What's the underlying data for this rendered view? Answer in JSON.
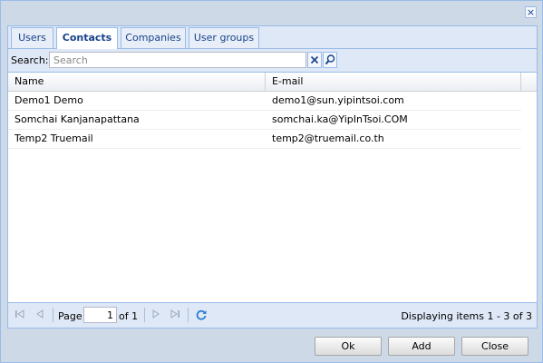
{
  "window": {
    "close_glyph": "×"
  },
  "tabs": [
    {
      "label": "Users",
      "active": false
    },
    {
      "label": "Contacts",
      "active": true
    },
    {
      "label": "Companies",
      "active": false
    },
    {
      "label": "User groups",
      "active": false
    }
  ],
  "search": {
    "label": "Search:",
    "placeholder": "Search",
    "value": ""
  },
  "grid": {
    "columns": [
      "Name",
      "E-mail"
    ],
    "rows": [
      {
        "name": "Demo1 Demo",
        "email": "demo1@sun.yipintsoi.com"
      },
      {
        "name": "Somchai Kanjanapattana",
        "email": "somchai.ka@YipInTsoi.COM"
      },
      {
        "name": "Temp2 Truemail",
        "email": "temp2@truemail.co.th"
      }
    ]
  },
  "pager": {
    "page_label": "Page",
    "current_page": "1",
    "of_label": "of 1",
    "status": "Displaying items 1 - 3 of 3"
  },
  "buttons": {
    "ok": "Ok",
    "add": "Add",
    "close": "Close"
  },
  "icons": {
    "close": "close-icon",
    "clear": "clear-search-icon",
    "search": "magnifier-icon",
    "first": "first-page-icon",
    "prev": "prev-page-icon",
    "next": "next-page-icon",
    "last": "last-page-icon",
    "refresh": "refresh-icon"
  },
  "colors": {
    "accent": "#15428b",
    "border": "#99bbe8",
    "toolbar": "#dfe8f6"
  }
}
